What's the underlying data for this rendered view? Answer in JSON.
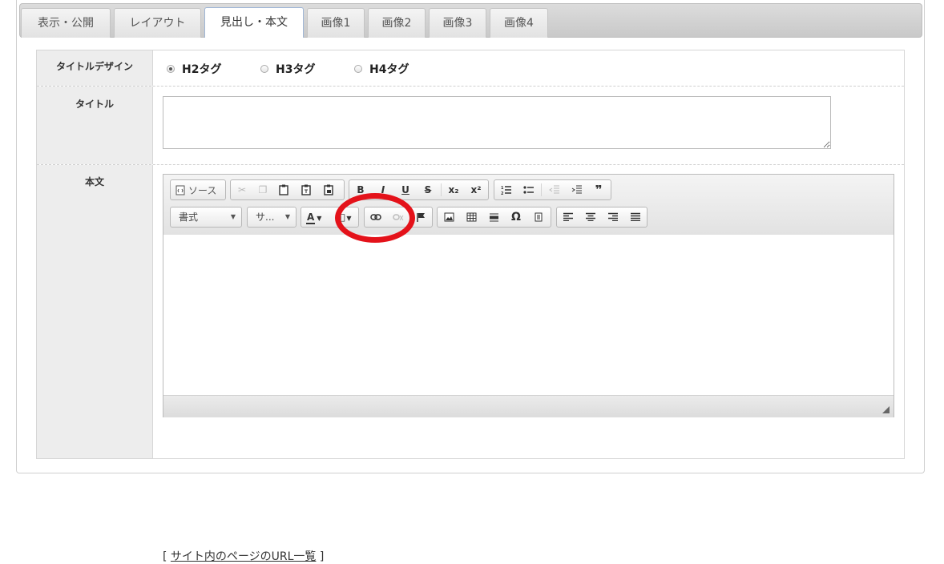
{
  "tabs": [
    {
      "label": "表示・公開",
      "active": false
    },
    {
      "label": "レイアウト",
      "active": false
    },
    {
      "label": "見出し・本文",
      "active": true
    },
    {
      "label": "画像1",
      "active": false
    },
    {
      "label": "画像2",
      "active": false
    },
    {
      "label": "画像3",
      "active": false
    },
    {
      "label": "画像4",
      "active": false
    }
  ],
  "form": {
    "title_design": {
      "label": "タイトルデザイン",
      "options": [
        {
          "label": "H2タグ",
          "selected": true
        },
        {
          "label": "H3タグ",
          "selected": false
        },
        {
          "label": "H4タグ",
          "selected": false
        }
      ]
    },
    "title": {
      "label": "タイトル",
      "value": ""
    },
    "body": {
      "label": "本文"
    }
  },
  "editor": {
    "source_label": "ソース",
    "format_label": "書式",
    "size_label": "サ...",
    "icons": {
      "source": "source-doc-icon",
      "cut": "cut-icon",
      "copy": "copy-icon",
      "paste": "paste-icon",
      "paste_text": "paste-text-icon",
      "paste_word": "paste-word-icon",
      "bold": "bold-icon",
      "italic": "italic-icon",
      "underline": "underline-icon",
      "strike": "strikethrough-icon",
      "subscript": "subscript-icon",
      "superscript": "superscript-icon",
      "ol": "numbered-list-icon",
      "ul": "bulleted-list-icon",
      "outdent": "outdent-icon",
      "indent": "indent-icon",
      "blockquote": "blockquote-icon",
      "text_color": "text-color-icon",
      "bg_color": "background-color-icon",
      "link": "link-icon",
      "unlink": "unlink-icon",
      "anchor": "anchor-flag-icon",
      "image": "image-icon",
      "table": "table-icon",
      "hr": "horizontal-rule-icon",
      "special_char": "omega-icon",
      "page_break": "page-break-icon",
      "align_left": "align-left-icon",
      "align_center": "align-center-icon",
      "align_right": "align-right-icon",
      "justify": "justify-icon"
    }
  },
  "url_list": {
    "bracket_open": "[",
    "link_text": "サイト内のページのURL一覧",
    "bracket_close": "]"
  },
  "colors": {
    "highlight_circle": "#e4121a",
    "active_tab_border": "#9fb6d6"
  }
}
